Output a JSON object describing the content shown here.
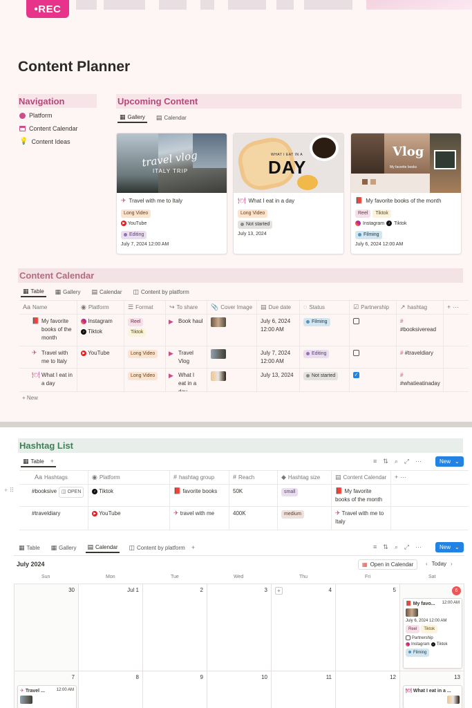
{
  "banner": {
    "logo": "•REC"
  },
  "page": {
    "title": "Content Planner"
  },
  "navigation": {
    "heading": "Navigation",
    "items": [
      {
        "label": "Platform"
      },
      {
        "label": "Content Calendar"
      },
      {
        "label": "Content Ideas"
      }
    ]
  },
  "upcoming": {
    "heading": "Upcoming Content",
    "tabs": [
      {
        "label": "Gallery"
      },
      {
        "label": "Calendar"
      }
    ],
    "cards": [
      {
        "title": "Travel with me to Italy",
        "img_text1": "travel vlog",
        "img_text2": "ITALY TRIP",
        "tag": "Long Video",
        "platform": "YouTube",
        "status": "Editing",
        "date": "July 7, 2024 12:00 AM"
      },
      {
        "title": "What I eat in a day",
        "img_text1": "WHAT I EAT IN A",
        "img_text2": "DAY",
        "tag": "Long Video",
        "status": "Not started",
        "date": "July 13, 2024"
      },
      {
        "title": "My favorite books of the month",
        "img_text1": "Vlog",
        "img_text2": "My favorite books",
        "tag1": "Reel",
        "tag2": "Tiktok",
        "platform1": "Instagram",
        "platform2": "Tiktok",
        "status": "Filming",
        "date": "July 6, 2024 12:00 AM"
      }
    ]
  },
  "content_calendar": {
    "heading": "Content Calendar",
    "tabs": [
      {
        "label": "Table"
      },
      {
        "label": "Gallery"
      },
      {
        "label": "Calendar"
      },
      {
        "label": "Content by platform"
      }
    ],
    "columns": [
      "Name",
      "Platform",
      "Format",
      "To share",
      "Cover Image",
      "Due date",
      "Status",
      "Partnership",
      "hashtag"
    ],
    "rows": [
      {
        "name": "My favorite books of the month",
        "platform1": "Instagram",
        "platform2": "Tiktok",
        "format1": "Reel",
        "format2": "Tiktok",
        "share": "Book haul",
        "due": "July 6, 2024 12:00 AM",
        "status": "Filming",
        "partnership": false,
        "hashtag": "#booksiveread"
      },
      {
        "name": "Travel with me to Italy",
        "platform1": "YouTube",
        "format1": "Long Video",
        "share": "Travel Vlog",
        "due": "July 7, 2024 12:00 AM",
        "status": "Editing",
        "partnership": false,
        "hashtag": "#traveldiary"
      },
      {
        "name": "What I eat in a day",
        "format1": "Long Video",
        "share": "What I eat in a day",
        "due": "July 13, 2024",
        "status": "Not started",
        "partnership": true,
        "hashtag": "#whatieatinaday"
      }
    ],
    "new_label": "New"
  },
  "hashtag_list": {
    "heading": "Hashtag List",
    "tab": "Table",
    "new_button": "New",
    "columns": [
      "Hashtags",
      "Platform",
      "hashtag group",
      "Reach",
      "Hashtag size",
      "Content Calendar"
    ],
    "rows": [
      {
        "hashtag": "#booksive",
        "open": "OPEN",
        "platform": "Tiktok",
        "group": "favorite books",
        "reach": "50K",
        "size": "small",
        "calendar": "My favorite books of the month"
      },
      {
        "hashtag": "#traveldiary",
        "platform": "YouTube",
        "group": "travel with me",
        "reach": "400K",
        "size": "medium",
        "calendar": "Travel with me to Italy"
      }
    ]
  },
  "calendar_view": {
    "tabs": [
      {
        "label": "Table"
      },
      {
        "label": "Gallery"
      },
      {
        "label": "Calendar"
      },
      {
        "label": "Content by platform"
      }
    ],
    "month": "July 2024",
    "open_in_calendar": "Open in Calendar",
    "today": "Today",
    "new_button": "New",
    "weekdays": [
      "Sun",
      "Mon",
      "Tue",
      "Wed",
      "Thu",
      "Fri",
      "Sat"
    ],
    "week1": [
      "30",
      "Jul 1",
      "2",
      "3",
      "4",
      "5",
      "6"
    ],
    "week2": [
      "7",
      "8",
      "9",
      "10",
      "11",
      "12",
      "13"
    ],
    "event_sat6": {
      "title": "My favo...",
      "time": "12:00 AM",
      "date": "July 6, 2024 12:00 AM",
      "tag1": "Reel",
      "tag2": "Tiktok",
      "partnership": "Partnership",
      "platform1": "Instagram",
      "platform2": "Tiktok",
      "status": "Filming"
    },
    "event_sun7": {
      "title": "Travel ...",
      "time": "12:00 AM"
    },
    "event_sat13": {
      "title": "What I eat in a ..."
    }
  },
  "colors": {
    "accent_pink": "#e8338a",
    "heading_pink": "#b64779",
    "heading_bg_pink": "#f7e4e9",
    "heading_green": "#3f7f55",
    "heading_bg_green": "#e8eee9",
    "new_blue": "#2383e2"
  }
}
